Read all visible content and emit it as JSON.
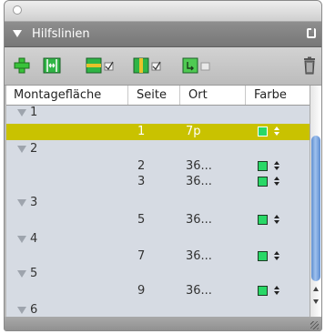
{
  "panel": {
    "title": "Hilfslinien"
  },
  "toolbar": {
    "icons": [
      "add-guide-icon",
      "distribute-guides-icon",
      "horizontal-guides-icon",
      "vertical-guides-icon",
      "snap-guides-icon",
      "trash-icon"
    ]
  },
  "table": {
    "columns": [
      "Montagefläche",
      "Seite",
      "Ort",
      "Farbe"
    ],
    "groups": [
      {
        "label": "1",
        "rows": [
          {
            "page": "1",
            "position": "7p",
            "color": "#29d867",
            "selected": true
          }
        ]
      },
      {
        "label": "2",
        "rows": [
          {
            "page": "2",
            "position": "36...",
            "color": "#29d867"
          },
          {
            "page": "3",
            "position": "36...",
            "color": "#29d867"
          }
        ]
      },
      {
        "label": "3",
        "rows": [
          {
            "page": "5",
            "position": "36...",
            "color": "#29d867"
          }
        ]
      },
      {
        "label": "4",
        "rows": [
          {
            "page": "7",
            "position": "36...",
            "color": "#29d867"
          }
        ]
      },
      {
        "label": "5",
        "rows": [
          {
            "page": "9",
            "position": "36...",
            "color": "#29d867"
          }
        ]
      },
      {
        "label": "6",
        "rows": []
      }
    ]
  }
}
